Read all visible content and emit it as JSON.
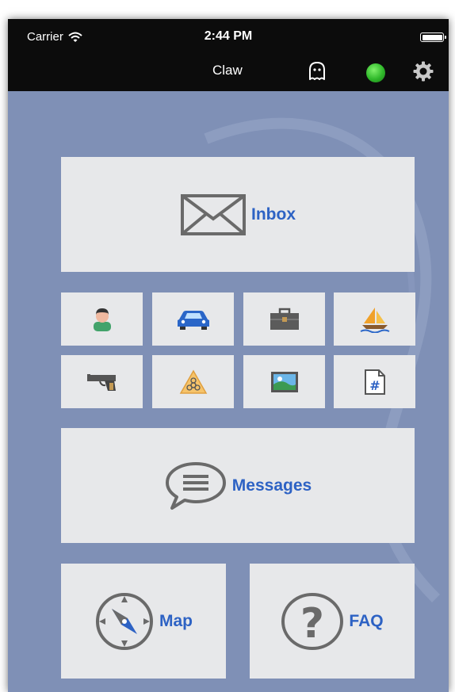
{
  "status_bar": {
    "carrier": "Carrier",
    "time": "2:44 PM"
  },
  "nav": {
    "title": "Claw"
  },
  "tiles": {
    "inbox": "Inbox",
    "messages": "Messages",
    "map": "Map",
    "faq": "FAQ"
  },
  "category_icons": [
    "person-icon",
    "car-icon",
    "briefcase-icon",
    "sailboat-icon",
    "gun-icon",
    "biohazard-icon",
    "picture-icon",
    "document-hash-icon"
  ],
  "colors": {
    "accent": "#2d62c4",
    "background": "#7f90b6",
    "tile": "#e7e8ea",
    "status_dot": "#2fb82a"
  }
}
